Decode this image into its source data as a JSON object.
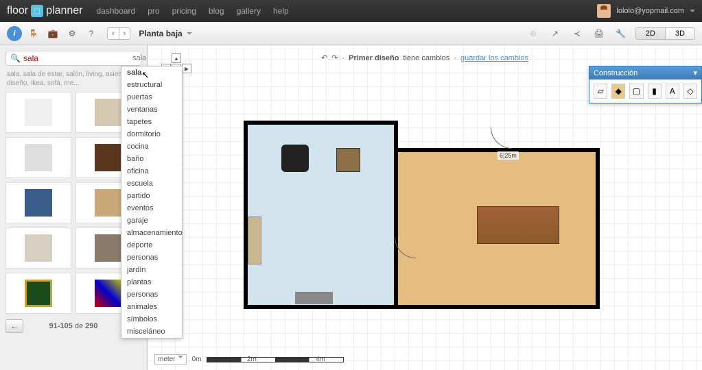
{
  "header": {
    "logo_left": "floor",
    "logo_right": "planner",
    "nav": [
      "dashboard",
      "pro",
      "pricing",
      "blog",
      "gallery",
      "help"
    ],
    "user_email": "lololo@yopmail.com"
  },
  "toolbar": {
    "floor_name": "Planta baja",
    "view_2d": "2D",
    "view_3d": "3D"
  },
  "sidebar": {
    "search_value": "sala",
    "filter_label": "sala",
    "tags": "sala, sala de estar, salón, living, asientos, diseño, ikea, sofá, me...",
    "pager_current": "91-105",
    "pager_of": "de",
    "pager_total": "290",
    "dropdown": [
      "sala",
      "estructural",
      "puertas",
      "ventanas",
      "tapetes",
      "dormitorio",
      "cocina",
      "baño",
      "oficina",
      "escuela",
      "partido",
      "eventos",
      "garaje",
      "almacenamiento",
      "deporte",
      "personas",
      "jardín",
      "plantas",
      "personas",
      "animales",
      "símbolos",
      "misceláneo"
    ]
  },
  "status": {
    "design_name": "Primer diseño",
    "has_changes": "tiene cambios",
    "save_link": "guardar los cambios",
    "sep": "·"
  },
  "canvas": {
    "dimension": "6¦25m"
  },
  "scale": {
    "unit": "meter",
    "t0": "0m",
    "t2": "2m",
    "t4": "4m"
  },
  "panel": {
    "title": "Construcción",
    "text_tool": "A"
  }
}
